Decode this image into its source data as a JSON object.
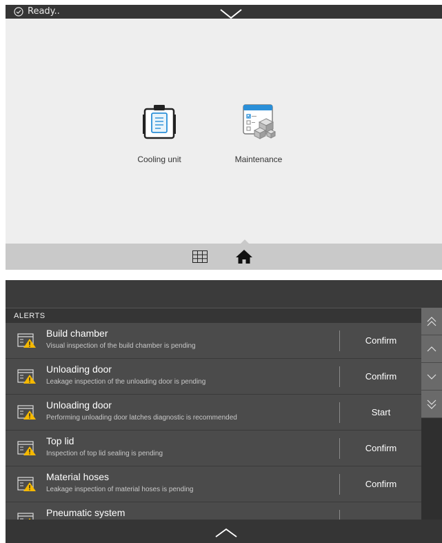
{
  "status": {
    "text": "Ready..",
    "icon": "check-circle-icon"
  },
  "header": {
    "collapse_icon": "chevron-down-icon"
  },
  "home": {
    "tiles": [
      {
        "label": "Cooling unit",
        "icon": "clipboard-icon"
      },
      {
        "label": "Maintenance",
        "icon": "calendar-cubes-icon"
      }
    ]
  },
  "nav": {
    "items": [
      {
        "name": "grid-icon"
      },
      {
        "name": "home-icon",
        "active": true
      }
    ]
  },
  "alerts": {
    "header": "ALERTS",
    "rows": [
      {
        "title": "Build chamber",
        "description": "Visual inspection of the build chamber is pending",
        "action": "Confirm"
      },
      {
        "title": "Unloading door",
        "description": "Leakage inspection of the unloading door is pending",
        "action": "Confirm"
      },
      {
        "title": "Unloading door",
        "description": "Performing unloading door latches diagnostic is recommended",
        "action": "Start"
      },
      {
        "title": "Top lid",
        "description": "Inspection of top lid sealing is pending",
        "action": "Confirm"
      },
      {
        "title": "Material hoses",
        "description": "Leakage inspection of material hoses is pending",
        "action": "Confirm"
      },
      {
        "title": "Pneumatic system",
        "description": "",
        "action": ""
      }
    ],
    "scroll_buttons": [
      "scroll-top-icon",
      "scroll-up-icon",
      "scroll-down-icon",
      "scroll-bottom-icon"
    ]
  },
  "colors": {
    "dark_bar": "#353535",
    "panel_light": "#eeeeee",
    "nav_bar": "#c9c9c9",
    "alert_row": "#4b4b4b",
    "warning": "#f5b800"
  }
}
